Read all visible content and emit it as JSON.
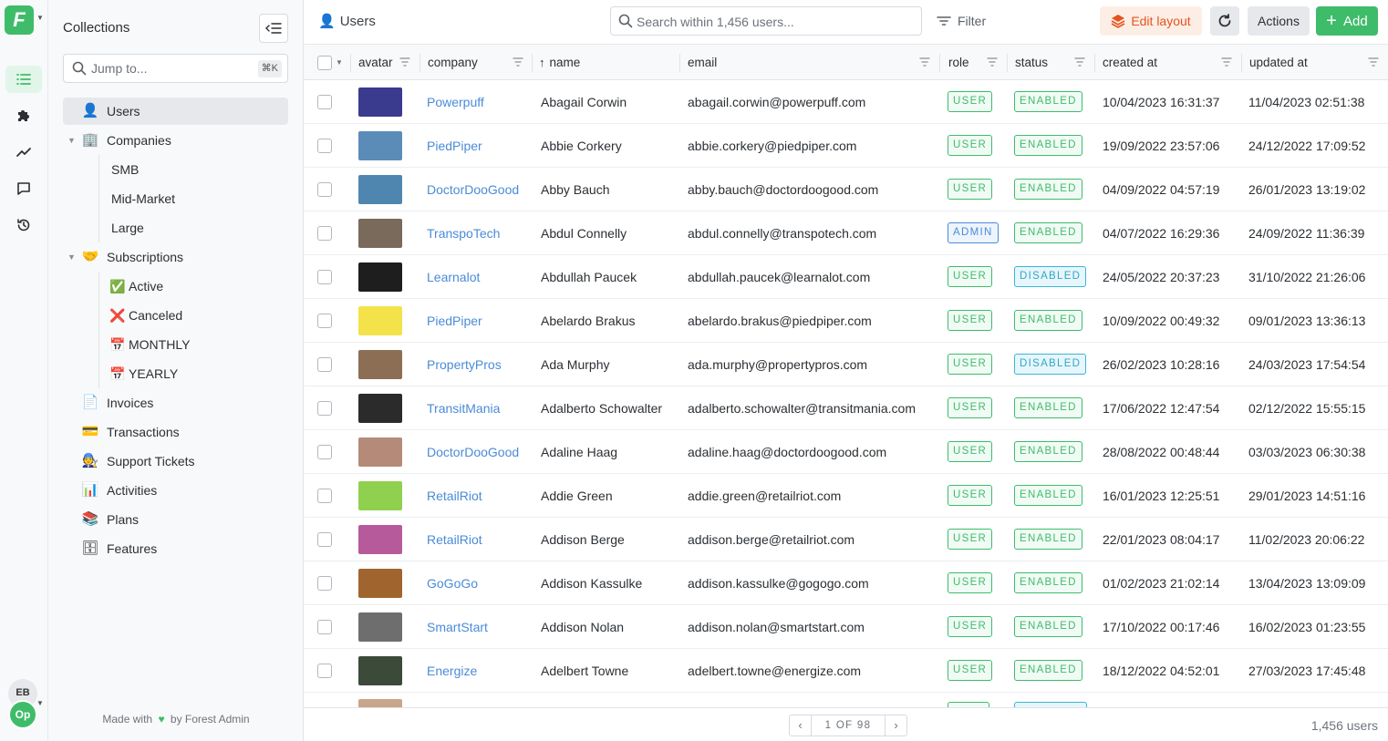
{
  "rail": {
    "logo": "F",
    "user_initials": "EB",
    "project_initials": "Op"
  },
  "sidebar": {
    "title": "Collections",
    "jump_placeholder": "Jump to...",
    "jump_shortcut": "⌘K",
    "items": [
      {
        "label": "Users",
        "icon": "👤"
      },
      {
        "label": "Companies",
        "icon": "🏢"
      },
      {
        "label": "SMB",
        "icon": ""
      },
      {
        "label": "Mid-Market",
        "icon": ""
      },
      {
        "label": "Large",
        "icon": ""
      },
      {
        "label": "Subscriptions",
        "icon": "🤝"
      },
      {
        "label": "Active",
        "icon": "✅"
      },
      {
        "label": "Canceled",
        "icon": "❌"
      },
      {
        "label": "MONTHLY",
        "icon": "📅"
      },
      {
        "label": "YEARLY",
        "icon": "📅"
      },
      {
        "label": "Invoices",
        "icon": "📄"
      },
      {
        "label": "Transactions",
        "icon": "💳"
      },
      {
        "label": "Support Tickets",
        "icon": "🧑‍🔧"
      },
      {
        "label": "Activities",
        "icon": "📊"
      },
      {
        "label": "Plans",
        "icon": "📚"
      },
      {
        "label": "Features",
        "icon": "🗄"
      }
    ],
    "footer_before": "Made with",
    "footer_after": "by Forest Admin"
  },
  "header": {
    "title": "Users",
    "search_placeholder": "Search within 1,456 users...",
    "filter_label": "Filter",
    "edit_layout_label": "Edit layout",
    "actions_label": "Actions",
    "add_label": "Add"
  },
  "table": {
    "columns": [
      "avatar",
      "company",
      "name",
      "email",
      "role",
      "status",
      "created at",
      "updated at"
    ],
    "rows": [
      {
        "avatar_color": "#3a3a8f",
        "company": "Powerpuff",
        "name": "Abagail Corwin",
        "email": "abagail.corwin@powerpuff.com",
        "role": "USER",
        "status": "ENABLED",
        "created": "10/04/2023 16:31:37",
        "updated": "11/04/2023 02:51:38"
      },
      {
        "avatar_color": "#5b8cb8",
        "company": "PiedPiper",
        "name": "Abbie Corkery",
        "email": "abbie.corkery@piedpiper.com",
        "role": "USER",
        "status": "ENABLED",
        "created": "19/09/2022 23:57:06",
        "updated": "24/12/2022 17:09:52"
      },
      {
        "avatar_color": "#4f86b0",
        "company": "DoctorDooGood",
        "name": "Abby Bauch",
        "email": "abby.bauch@doctordoogood.com",
        "role": "USER",
        "status": "ENABLED",
        "created": "04/09/2022 04:57:19",
        "updated": "26/01/2023 13:19:02"
      },
      {
        "avatar_color": "#7a6a5c",
        "company": "TranspoTech",
        "name": "Abdul Connelly",
        "email": "abdul.connelly@transpotech.com",
        "role": "ADMIN",
        "status": "ENABLED",
        "created": "04/07/2022 16:29:36",
        "updated": "24/09/2022 11:36:39"
      },
      {
        "avatar_color": "#1e1e1e",
        "company": "Learnalot",
        "name": "Abdullah Paucek",
        "email": "abdullah.paucek@learnalot.com",
        "role": "USER",
        "status": "DISABLED",
        "created": "24/05/2022 20:37:23",
        "updated": "31/10/2022 21:26:06"
      },
      {
        "avatar_color": "#f3e24a",
        "company": "PiedPiper",
        "name": "Abelardo Brakus",
        "email": "abelardo.brakus@piedpiper.com",
        "role": "USER",
        "status": "ENABLED",
        "created": "10/09/2022 00:49:32",
        "updated": "09/01/2023 13:36:13"
      },
      {
        "avatar_color": "#8c6e55",
        "company": "PropertyPros",
        "name": "Ada Murphy",
        "email": "ada.murphy@propertypros.com",
        "role": "USER",
        "status": "DISABLED",
        "created": "26/02/2023 10:28:16",
        "updated": "24/03/2023 17:54:54"
      },
      {
        "avatar_color": "#2b2b2b",
        "company": "TransitMania",
        "name": "Adalberto Schowalter",
        "email": "adalberto.schowalter@transitmania.com",
        "role": "USER",
        "status": "ENABLED",
        "created": "17/06/2022 12:47:54",
        "updated": "02/12/2022 15:55:15"
      },
      {
        "avatar_color": "#b58a78",
        "company": "DoctorDooGood",
        "name": "Adaline Haag",
        "email": "adaline.haag@doctordoogood.com",
        "role": "USER",
        "status": "ENABLED",
        "created": "28/08/2022 00:48:44",
        "updated": "03/03/2023 06:30:38"
      },
      {
        "avatar_color": "#8fd14f",
        "company": "RetailRiot",
        "name": "Addie Green",
        "email": "addie.green@retailriot.com",
        "role": "USER",
        "status": "ENABLED",
        "created": "16/01/2023 12:25:51",
        "updated": "29/01/2023 14:51:16"
      },
      {
        "avatar_color": "#b65a9c",
        "company": "RetailRiot",
        "name": "Addison Berge",
        "email": "addison.berge@retailriot.com",
        "role": "USER",
        "status": "ENABLED",
        "created": "22/01/2023 08:04:17",
        "updated": "11/02/2023 20:06:22"
      },
      {
        "avatar_color": "#a0652f",
        "company": "GoGoGo",
        "name": "Addison Kassulke",
        "email": "addison.kassulke@gogogo.com",
        "role": "USER",
        "status": "ENABLED",
        "created": "01/02/2023 21:02:14",
        "updated": "13/04/2023 13:09:09"
      },
      {
        "avatar_color": "#6e6e6e",
        "company": "SmartStart",
        "name": "Addison Nolan",
        "email": "addison.nolan@smartstart.com",
        "role": "USER",
        "status": "ENABLED",
        "created": "17/10/2022 00:17:46",
        "updated": "16/02/2023 01:23:55"
      },
      {
        "avatar_color": "#3c4a3a",
        "company": "Energize",
        "name": "Adelbert Towne",
        "email": "adelbert.towne@energize.com",
        "role": "USER",
        "status": "ENABLED",
        "created": "18/12/2022 04:52:01",
        "updated": "27/03/2023 17:45:48"
      }
    ]
  },
  "footer": {
    "pager_text": "1 OF 98",
    "total": "1,456 users"
  },
  "colors": {
    "brand_green": "#3fbc6a",
    "link_blue": "#4a8bd8",
    "edit_orange": "#e5531e"
  }
}
